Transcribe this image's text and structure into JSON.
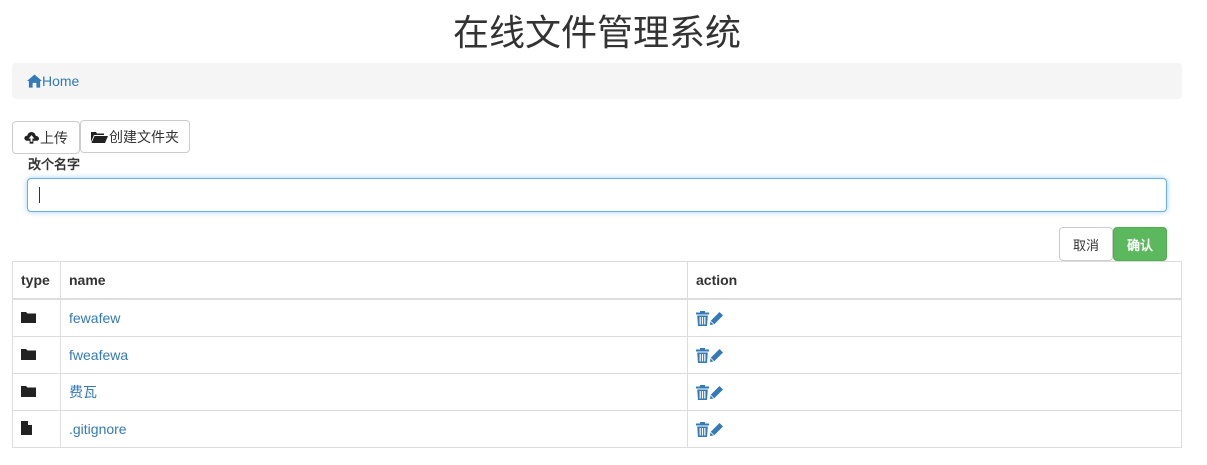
{
  "header": {
    "title": "在线文件管理系统"
  },
  "breadcrumb": {
    "home_label": "Home"
  },
  "toolbar": {
    "upload_label": "上传",
    "mkdir_label": "创建文件夹"
  },
  "rename_form": {
    "label": "改个名字",
    "value": "",
    "cancel_label": "取消",
    "confirm_label": "确认"
  },
  "table": {
    "headers": {
      "type": "type",
      "name": "name",
      "action": "action"
    },
    "rows": [
      {
        "type": "folder",
        "name": "fewafew"
      },
      {
        "type": "folder",
        "name": "fweafewa"
      },
      {
        "type": "folder",
        "name": "费瓦"
      },
      {
        "type": "file",
        "name": ".gitignore"
      }
    ]
  },
  "icons": {
    "home": "home-icon",
    "upload": "cloud-upload-icon",
    "mkdir": "folder-open-icon",
    "folder": "folder-icon",
    "file": "file-icon",
    "delete": "trash-icon",
    "edit": "pencil-icon"
  },
  "colors": {
    "link": "#337ab7",
    "confirm": "#5cb85c",
    "focus": "#66afe9"
  }
}
